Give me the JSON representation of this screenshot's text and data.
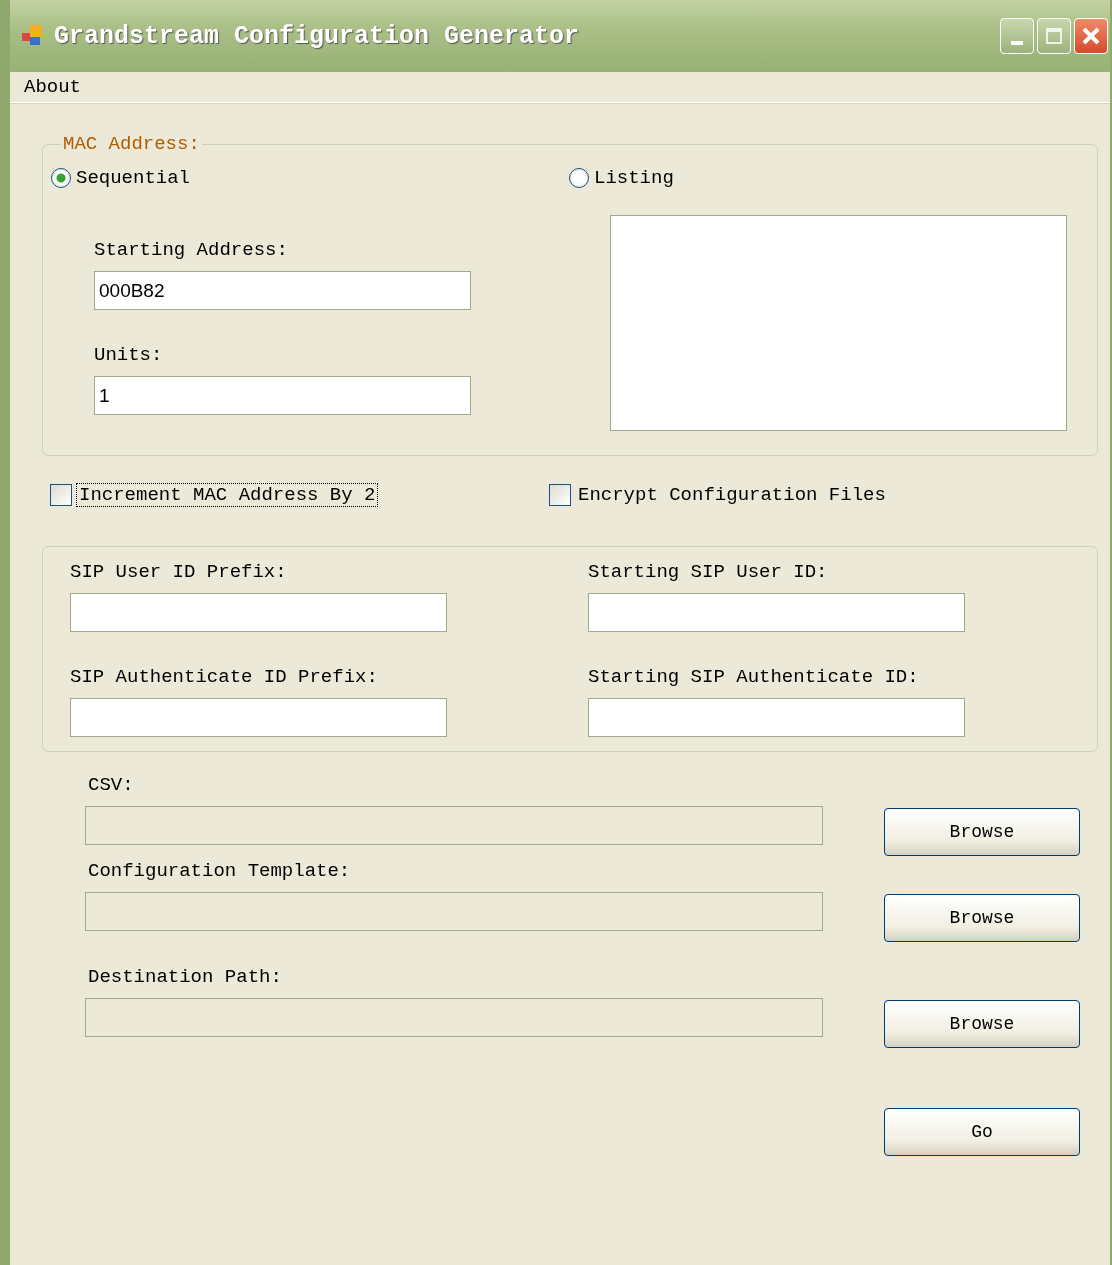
{
  "window": {
    "title": "Grandstream Configuration Generator"
  },
  "menu": [
    {
      "label": "About"
    }
  ],
  "mac_group": {
    "legend": "MAC Address:",
    "modes": [
      {
        "label": "Sequential",
        "selected": true
      },
      {
        "label": "Listing",
        "selected": false
      }
    ],
    "fields": [
      {
        "label": "Starting Address:",
        "value": "000B82"
      },
      {
        "label": "Units:",
        "value": "1"
      }
    ]
  },
  "options": [
    {
      "label": "Increment MAC Address By 2",
      "checked": false,
      "focused": true
    },
    {
      "label": "Encrypt Configuration Files",
      "checked": false,
      "focused": false
    }
  ],
  "sip_group": {
    "fields": [
      {
        "label": "SIP User ID Prefix:"
      },
      {
        "label": "Starting SIP User ID:"
      },
      {
        "label": "SIP Authenticate ID Prefix:"
      },
      {
        "label": "Starting SIP Authenticate ID:"
      }
    ]
  },
  "files": [
    {
      "label": "CSV:",
      "button": "Browse",
      "disabled": true
    },
    {
      "label": "Configuration Template:",
      "button": "Browse",
      "disabled": true
    },
    {
      "label": "Destination Path:",
      "button": "Browse",
      "disabled": true
    }
  ],
  "go_button": "Go"
}
